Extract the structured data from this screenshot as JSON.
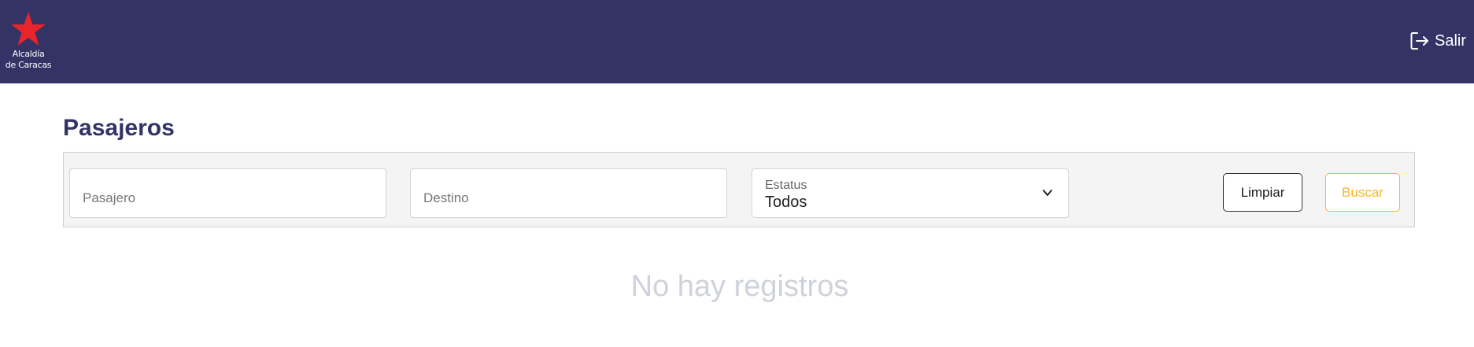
{
  "header": {
    "logo": {
      "line1": "Alcaldía",
      "line2": "de Caracas",
      "icon": "red-star-icon",
      "star_color": "#e8242c"
    },
    "logout_label": "Salir",
    "logout_icon": "logout-icon",
    "bg_color": "#333366"
  },
  "page": {
    "title": "Pasajeros"
  },
  "filters": {
    "pasajero": {
      "placeholder": "Pasajero",
      "value": ""
    },
    "destino": {
      "placeholder": "Destino",
      "value": ""
    },
    "estatus": {
      "label": "Estatus",
      "selected": "Todos",
      "icon": "chevron-down-icon"
    },
    "clear_label": "Limpiar",
    "search_label": "Buscar",
    "search_color": "#f5b72a"
  },
  "results": {
    "empty_message": "No hay registros"
  }
}
